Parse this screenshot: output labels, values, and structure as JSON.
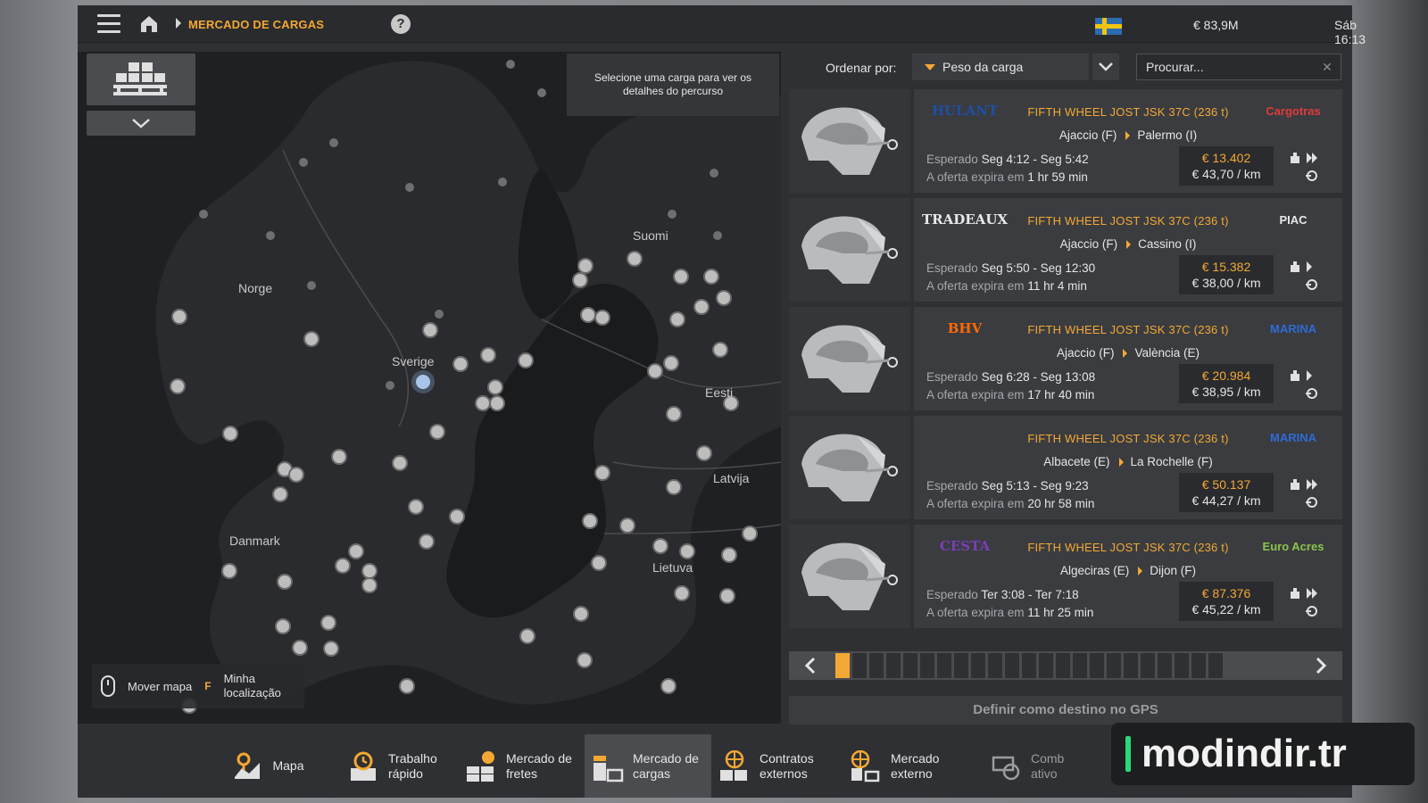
{
  "topbar": {
    "breadcrumb": "MERCADO DE CARGAS",
    "help": "?",
    "money": "€ 83,9M",
    "time": "Sáb 16:13"
  },
  "map": {
    "tooltip": "Selecione uma carga para ver os detalhes do percurso",
    "countries": [
      "Norge",
      "Sverige",
      "Suomi",
      "Eesti",
      "Latvija",
      "Danmark",
      "Lietuva"
    ],
    "hint_move": "Mover mapa",
    "hint_key": "F",
    "hint_location": "Minha localização"
  },
  "sort": {
    "label": "Ordenar por:",
    "value": "Peso da carga",
    "search_placeholder": "Procurar..."
  },
  "jobs": [
    {
      "logo_left": "HULANT",
      "logo_right": "Cargotras",
      "cargo": "FIFTH WHEEL JOST JSK 37C (236 t)",
      "from": "Ajaccio (F)",
      "to": "Palermo (I)",
      "expected_label": "Esperado",
      "expected": "Seg 4:12 - Seg 5:42",
      "expire_label": "A oferta expira em",
      "expire": "1 hr 59 min",
      "price": "€ 13.402",
      "per_km": "€ 43,70 / km",
      "double_arrow": true
    },
    {
      "logo_left": "TRADEAUX",
      "logo_right": "PIAC",
      "cargo": "FIFTH WHEEL JOST JSK 37C (236 t)",
      "from": "Ajaccio (F)",
      "to": "Cassino (I)",
      "expected_label": "Esperado",
      "expected": "Seg 5:50 - Seg 12:30",
      "expire_label": "A oferta expira em",
      "expire": "11 hr 4 min",
      "price": "€ 15.382",
      "per_km": "€ 38,00 / km",
      "double_arrow": false
    },
    {
      "logo_left": "BHV",
      "logo_right": "MARINA",
      "cargo": "FIFTH WHEEL JOST JSK 37C (236 t)",
      "from": "Ajaccio (F)",
      "to": "València (E)",
      "expected_label": "Esperado",
      "expected": "Seg 6:28 - Seg 13:08",
      "expire_label": "A oferta expira em",
      "expire": "17 hr 40 min",
      "price": "€ 20.984",
      "per_km": "€ 38,95 / km",
      "double_arrow": false
    },
    {
      "logo_left": "",
      "logo_right": "MARINA",
      "cargo": "FIFTH WHEEL JOST JSK 37C (236 t)",
      "from": "Albacete (E)",
      "to": "La Rochelle (F)",
      "expected_label": "Esperado",
      "expected": "Seg 5:13 - Seg 9:23",
      "expire_label": "A oferta expira em",
      "expire": "20 hr 58 min",
      "price": "€ 50.137",
      "per_km": "€ 44,27 / km",
      "double_arrow": true
    },
    {
      "logo_left": "CESTA",
      "logo_right": "Euro Acres",
      "cargo": "FIFTH WHEEL JOST JSK 37C (236 t)",
      "from": "Algeciras (E)",
      "to": "Dijon (F)",
      "expected_label": "Esperado",
      "expected": "Ter 3:08 - Ter 7:18",
      "expire_label": "A oferta expira em",
      "expire": "11 hr 25 min",
      "price": "€ 87.376",
      "per_km": "€ 45,22 / km",
      "double_arrow": true
    }
  ],
  "pager": {
    "total": 23,
    "current": 1
  },
  "gps_button": "Definir como destino no GPS",
  "nav": [
    {
      "label": "Mapa",
      "icon": "map-icon"
    },
    {
      "label": "Trabalho rápido",
      "icon": "quick-job-icon"
    },
    {
      "label": "Mercado de fretes",
      "icon": "freight-market-icon"
    },
    {
      "label": "Mercado de cargas",
      "icon": "cargo-market-icon",
      "active": true
    },
    {
      "label": "Contratos externos",
      "icon": "external-contracts-icon"
    },
    {
      "label": "Mercado externo",
      "icon": "external-market-icon"
    },
    {
      "label": "Comb ativo",
      "icon": "combined-icon"
    }
  ],
  "watermark": "modindir.tr",
  "colors": {
    "accent": "#f3a833",
    "panel": "#3a3c40",
    "background": "#2f3033"
  }
}
